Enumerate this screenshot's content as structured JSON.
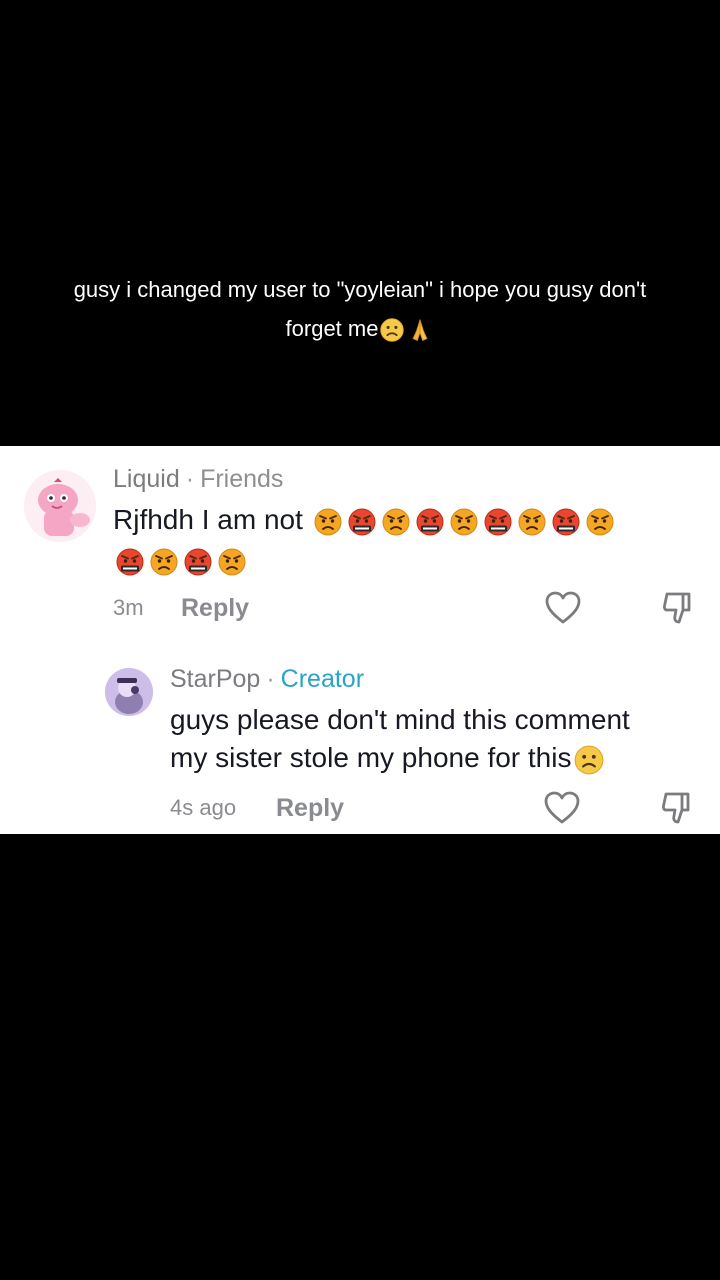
{
  "video": {
    "caption_line1": "gusy i changed my user to \"yoyleian\" i hope you gusy don't",
    "caption_line2": "forget me"
  },
  "comments": [
    {
      "username": "Liquid",
      "tag": "Friends",
      "text": "Rjfhdh I am not",
      "emojis_line1": [
        "angry-face",
        "cursing-face",
        "angry-face",
        "cursing-face",
        "angry-face",
        "cursing-face",
        "angry-face",
        "cursing-face",
        "angry-face"
      ],
      "emojis_line2": [
        "cursing-face",
        "angry-face",
        "cursing-face",
        "angry-face"
      ],
      "time": "3m",
      "reply_label": "Reply"
    },
    {
      "username": "StarPop",
      "tag": "Creator",
      "text_line1": "guys please don't mind this comment",
      "text_line2": "my sister stole my phone for this",
      "time": "4s ago",
      "reply_label": "Reply"
    }
  ],
  "colors": {
    "background": "#000000",
    "card": "#ffffff",
    "creator_tag": "#2aa4c5",
    "meta": "#8a8b91",
    "text": "#161823"
  }
}
